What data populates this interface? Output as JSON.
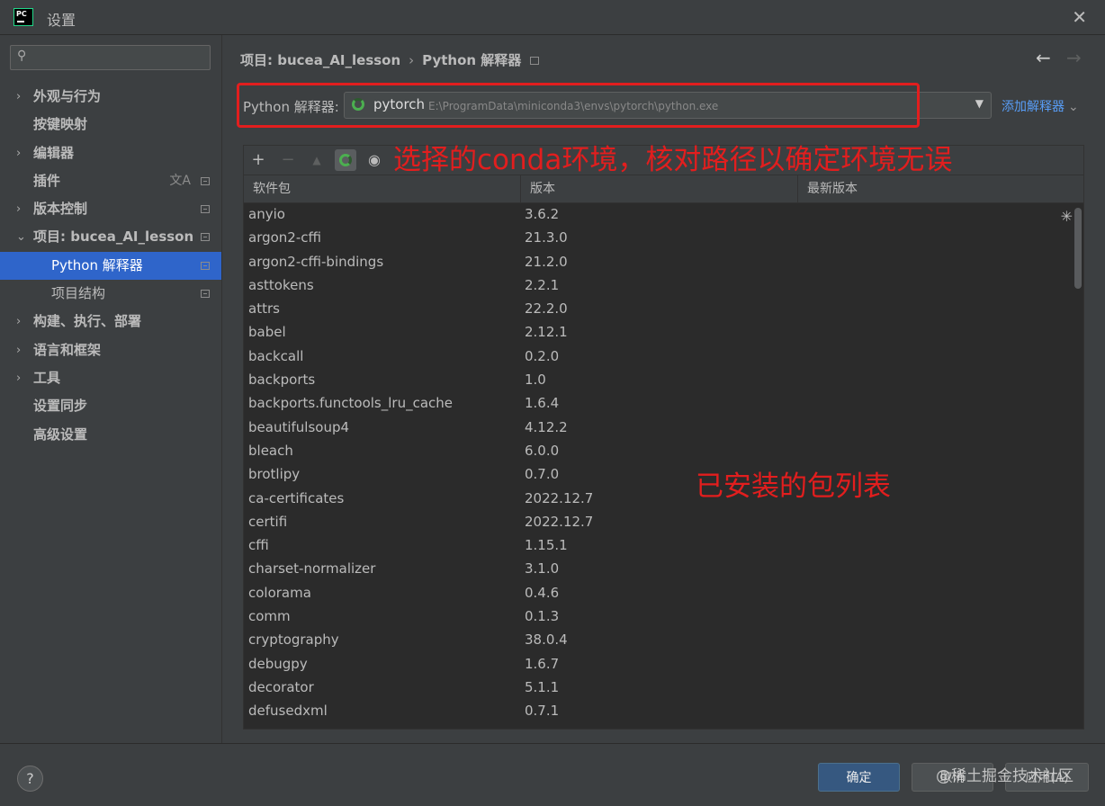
{
  "window": {
    "title": "设置",
    "close_icon": "✕"
  },
  "sidebar": {
    "search_placeholder": "",
    "items": [
      {
        "label": "外观与行为",
        "arrow": "›",
        "bold": true
      },
      {
        "label": "按键映射",
        "bold": true
      },
      {
        "label": "编辑器",
        "arrow": "›",
        "bold": true
      },
      {
        "label": "插件",
        "bold": true
      },
      {
        "label": "版本控制",
        "arrow": "›",
        "bold": true
      },
      {
        "label": "项目: bucea_AI_lesson",
        "arrow": "⌄",
        "bold": true
      },
      {
        "label": "Python 解释器",
        "selected": true
      },
      {
        "label": "项目结构"
      },
      {
        "label": "构建、执行、部署",
        "arrow": "›",
        "bold": true
      },
      {
        "label": "语言和框架",
        "arrow": "›",
        "bold": true
      },
      {
        "label": "工具",
        "arrow": "›",
        "bold": true
      },
      {
        "label": "设置同步",
        "bold": true
      },
      {
        "label": "高级设置",
        "bold": true
      }
    ]
  },
  "breadcrumb": {
    "project": "项目: bucea_AI_lesson",
    "page": "Python 解释器",
    "sep": "›"
  },
  "interpreter": {
    "label": "Python 解释器:",
    "name": "pytorch",
    "path": "E:\\ProgramData\\miniconda3\\envs\\pytorch\\python.exe",
    "add_label": "添加解释器"
  },
  "annotations": {
    "env_note": "选择的conda环境，核对路径以确定环境无误",
    "list_note": "已安装的包列表"
  },
  "table": {
    "headers": [
      "软件包",
      "版本",
      "最新版本"
    ],
    "rows": [
      [
        "anyio",
        "3.6.2"
      ],
      [
        "argon2-cffi",
        "21.3.0"
      ],
      [
        "argon2-cffi-bindings",
        "21.2.0"
      ],
      [
        "asttokens",
        "2.2.1"
      ],
      [
        "attrs",
        "22.2.0"
      ],
      [
        "babel",
        "2.12.1"
      ],
      [
        "backcall",
        "0.2.0"
      ],
      [
        "backports",
        "1.0"
      ],
      [
        "backports.functools_lru_cache",
        "1.6.4"
      ],
      [
        "beautifulsoup4",
        "4.12.2"
      ],
      [
        "bleach",
        "6.0.0"
      ],
      [
        "brotlipy",
        "0.7.0"
      ],
      [
        "ca-certificates",
        "2022.12.7"
      ],
      [
        "certifi",
        "2022.12.7"
      ],
      [
        "cffi",
        "1.15.1"
      ],
      [
        "charset-normalizer",
        "3.1.0"
      ],
      [
        "colorama",
        "0.4.6"
      ],
      [
        "comm",
        "0.1.3"
      ],
      [
        "cryptography",
        "38.0.4"
      ],
      [
        "debugpy",
        "1.6.7"
      ],
      [
        "decorator",
        "5.1.1"
      ],
      [
        "defusedxml",
        "0.7.1"
      ]
    ]
  },
  "buttons": {
    "ok": "确定",
    "cancel": "取消",
    "apply": "应用(A)"
  },
  "watermark": "@稀土掘金技术社区",
  "help_label": "?",
  "colors": {
    "accent": "#2f65ca",
    "annotation": "#e21e1e",
    "ok_button": "#365880"
  }
}
